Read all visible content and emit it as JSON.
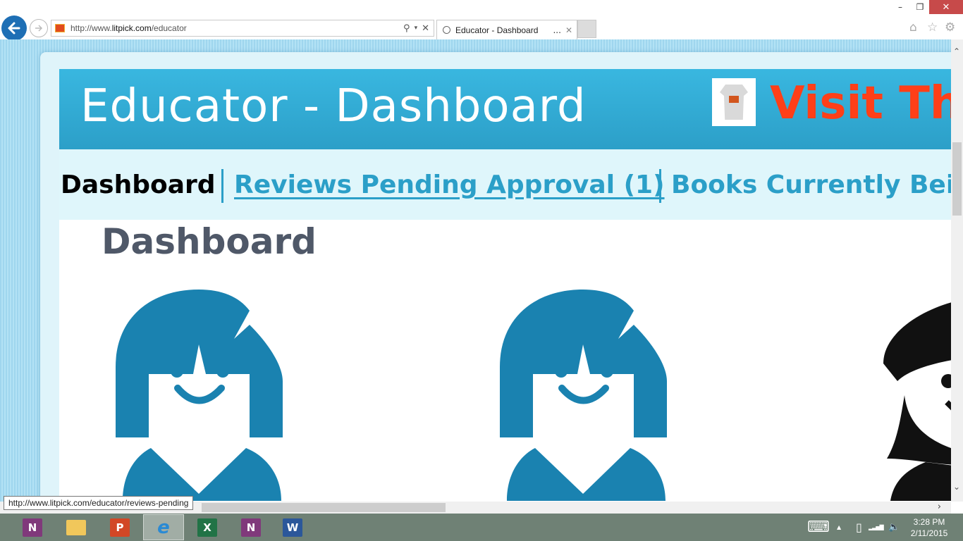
{
  "window": {
    "minimize_icon": "minimize-icon",
    "maximize_icon": "restore-icon",
    "close_icon": "close-icon",
    "minimize_glyph": "–",
    "restore_glyph": "❐",
    "close_glyph": "✕"
  },
  "browser": {
    "back_glyph": "←",
    "forward_glyph": "→",
    "url_prefix": "http://www.",
    "url_host": "litpick.com",
    "url_path": "/educator",
    "search_glyph": "⚲",
    "dropdown_glyph": "▾",
    "stop_glyph": "✕",
    "tab_title": "Educator - Dashboard",
    "tab_ellipsis": "...",
    "tab_close_glyph": "✕",
    "home_glyph": "⌂",
    "favorites_glyph": "☆",
    "settings_glyph": "⚙"
  },
  "page": {
    "banner_title": "Educator - Dashboard",
    "promo_text": "Visit The",
    "nav": [
      {
        "label": "Dashboard",
        "active": true
      },
      {
        "label": "Reviews Pending Approval (1)",
        "active": false
      },
      {
        "label": "Books Currently Being",
        "active": false
      }
    ],
    "content_heading": "Dashboard",
    "avatars": [
      {
        "name": "girl-avatar",
        "color": "#1a82b0"
      },
      {
        "name": "girl-avatar",
        "color": "#1a82b0"
      },
      {
        "name": "beret-avatar",
        "color": "#111111"
      }
    ],
    "colors": {
      "banner": "#34aad6",
      "promo": "#ff3f18",
      "link": "#2b9fc8"
    }
  },
  "scrollbars": {
    "up_glyph": "⌃",
    "down_glyph": "⌄",
    "right_glyph": "›"
  },
  "status_tooltip": "http://www.litpick.com/educator/reviews-pending",
  "taskbar": {
    "apps": [
      {
        "name": "onenote",
        "letter": "N",
        "color": "#80397b"
      },
      {
        "name": "file-explorer",
        "letter": "",
        "color": "#f1c75b"
      },
      {
        "name": "powerpoint",
        "letter": "P",
        "color": "#d24726"
      },
      {
        "name": "internet-explorer",
        "letter": "e",
        "color": "#2a8ad4"
      },
      {
        "name": "excel",
        "letter": "X",
        "color": "#217346"
      },
      {
        "name": "onenote-clipper",
        "letter": "N",
        "color": "#80397b"
      },
      {
        "name": "word",
        "letter": "W",
        "color": "#2b579a"
      }
    ],
    "tray": {
      "keyboard_glyph": "⌨",
      "chevron_glyph": "▲",
      "battery_glyph": "▯",
      "signal_glyph": "▂▃▅▇",
      "volume_glyph": "🔈"
    },
    "time": "3:28 PM",
    "date": "2/11/2015"
  }
}
